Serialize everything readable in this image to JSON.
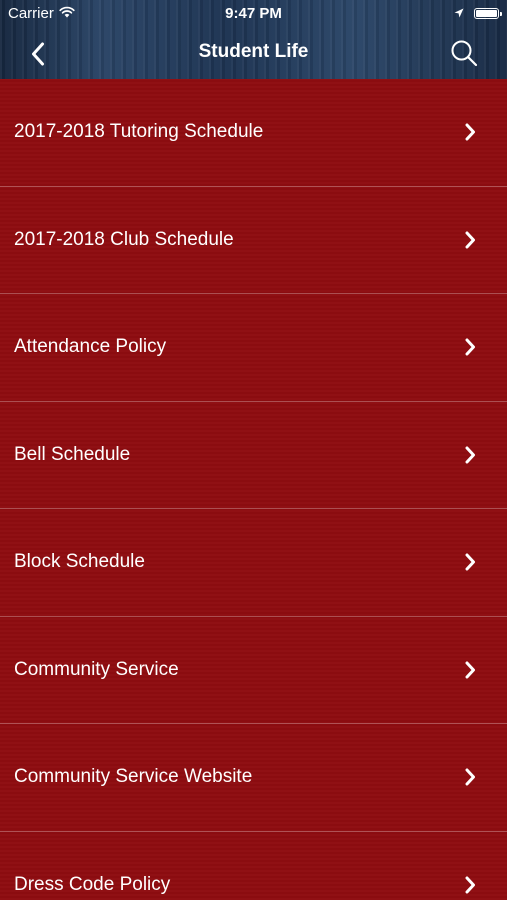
{
  "status_bar": {
    "carrier": "Carrier",
    "time": "9:47 PM",
    "icons": [
      "wifi-icon",
      "location-arrow-icon",
      "battery-icon"
    ]
  },
  "nav": {
    "title": "Student Life",
    "back_icon": "chevron-left-icon",
    "search_icon": "search-icon"
  },
  "list": {
    "items": [
      {
        "label": "2017-2018 Tutoring Schedule"
      },
      {
        "label": "2017-2018 Club Schedule"
      },
      {
        "label": "Attendance Policy"
      },
      {
        "label": "Bell Schedule"
      },
      {
        "label": "Block Schedule"
      },
      {
        "label": "Community Service"
      },
      {
        "label": "Community Service Website"
      },
      {
        "label": "Dress Code Policy"
      }
    ],
    "chevron_icon": "chevron-right-icon"
  },
  "colors": {
    "list_background": "#8e0c10",
    "header_background": "#1f3656",
    "text": "#ffffff"
  }
}
